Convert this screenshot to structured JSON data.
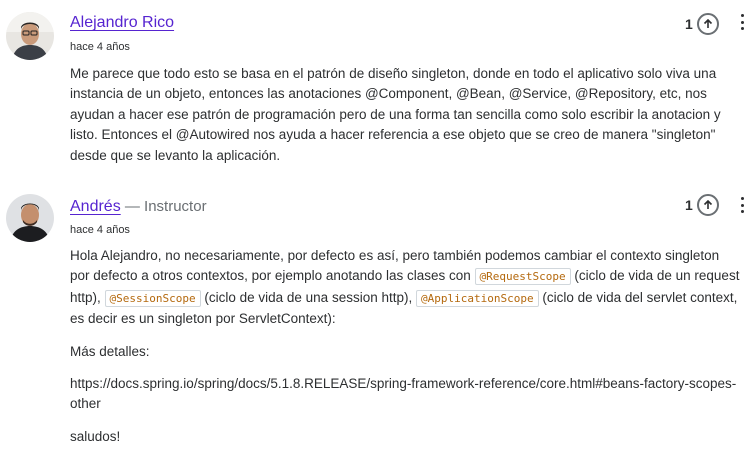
{
  "comments": [
    {
      "author": "Alejandro Rico",
      "role": "",
      "time": "hace 4 años",
      "votes": "1",
      "body_p1": "Me parece que todo esto se basa en el patrón de diseño singleton, donde en todo el aplicativo solo viva una instancia de un objeto, entonces las anotaciones @Component, @Bean, @Service, @Repository, etc, nos ayudan a hacer ese patrón de programación pero de una forma tan sencilla como solo escribir la anotacion y listo. Entonces el @Autowired nos ayuda a hacer referencia a ese objeto que se creo de manera \"singleton\" desde que se levanto la aplicación."
    },
    {
      "author": "Andrés",
      "role": " — Instructor",
      "time": "hace 4 años",
      "votes": "1",
      "p1_a": "Hola Alejandro, no necesariamente, por defecto es así, pero también podemos cambiar el contexto singleton por defecto a otros contextos, por ejemplo anotando las clases con ",
      "code1": "@RequestScope",
      "p1_b": " (ciclo de vida de un request http), ",
      "code2": "@SessionScope",
      "p1_c": "  (ciclo de vida de una session http), ",
      "code3": "@ApplicationScope",
      "p1_d": "  (ciclo de vida del servlet context, es decir es un singleton por ServletContext):",
      "p2": "Más detalles:",
      "p3": "https://docs.spring.io/spring/docs/5.1.8.RELEASE/spring-framework-reference/core.html#beans-factory-scopes-other",
      "p4": "saludos!"
    }
  ],
  "icons": {
    "avatar": "user-avatar",
    "upvote": "arrow-up-circle-icon",
    "more": "vertical-ellipsis-icon"
  },
  "colors": {
    "author_link": "#5624d0",
    "code_text": "#b4690e",
    "text": "#2d2f31",
    "muted": "#6a6f73"
  }
}
